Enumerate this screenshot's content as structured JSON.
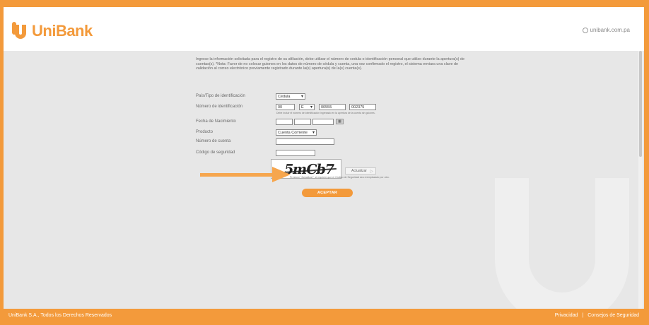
{
  "header": {
    "logo_text": "UniBank",
    "site_link": "unibank.com.pa"
  },
  "intro": {
    "text": "Ingrese la información solicitada para el registro de su afiliación, debe utilizar el número de cedula o identificación personal que utilizo durante la apertura(s) de cuentas(s). *Nota: Favor de no colocar guiones en los datos de número de cédula y cuenta, una vez confirmado el registro, el sistema enviara una clave de validación al correo electrónico previamente registrado durante la(s) apertura(s) de la(s) cuenta(s)."
  },
  "form": {
    "country_label": "País/Tipo de identificación",
    "country_value": "Cédula",
    "id_label": "Número de identificación",
    "id_part1": "00",
    "id_part2": "E",
    "id_part3": "00555",
    "id_part4": "002375",
    "id_note": "Debe incluir el número de identificación ingresado en la apertura de la cuenta sin guiones.",
    "birth_label": "Fecha de Nacimiento",
    "product_label": "Producto",
    "product_value": "Cuenta Corriente",
    "account_label": "Número de cuenta",
    "security_label": "Código de seguridad",
    "captcha_text": "5mCb7",
    "refresh_label": "Actualizar",
    "captcha_note": "Presione \"Actualizar\", si requiere que el Código de Seguridad sea reemplazado por otro.",
    "accept_label": "ACEPTAR"
  },
  "footer": {
    "copyright": "UniBank S.A., Todos los Derechos Reservados",
    "privacy": "Privacidad",
    "separator": "|",
    "security_tips": "Consejos de Seguridad"
  },
  "colors": {
    "brand_orange": "#f39a3b",
    "content_bg": "#e7e7e7"
  }
}
